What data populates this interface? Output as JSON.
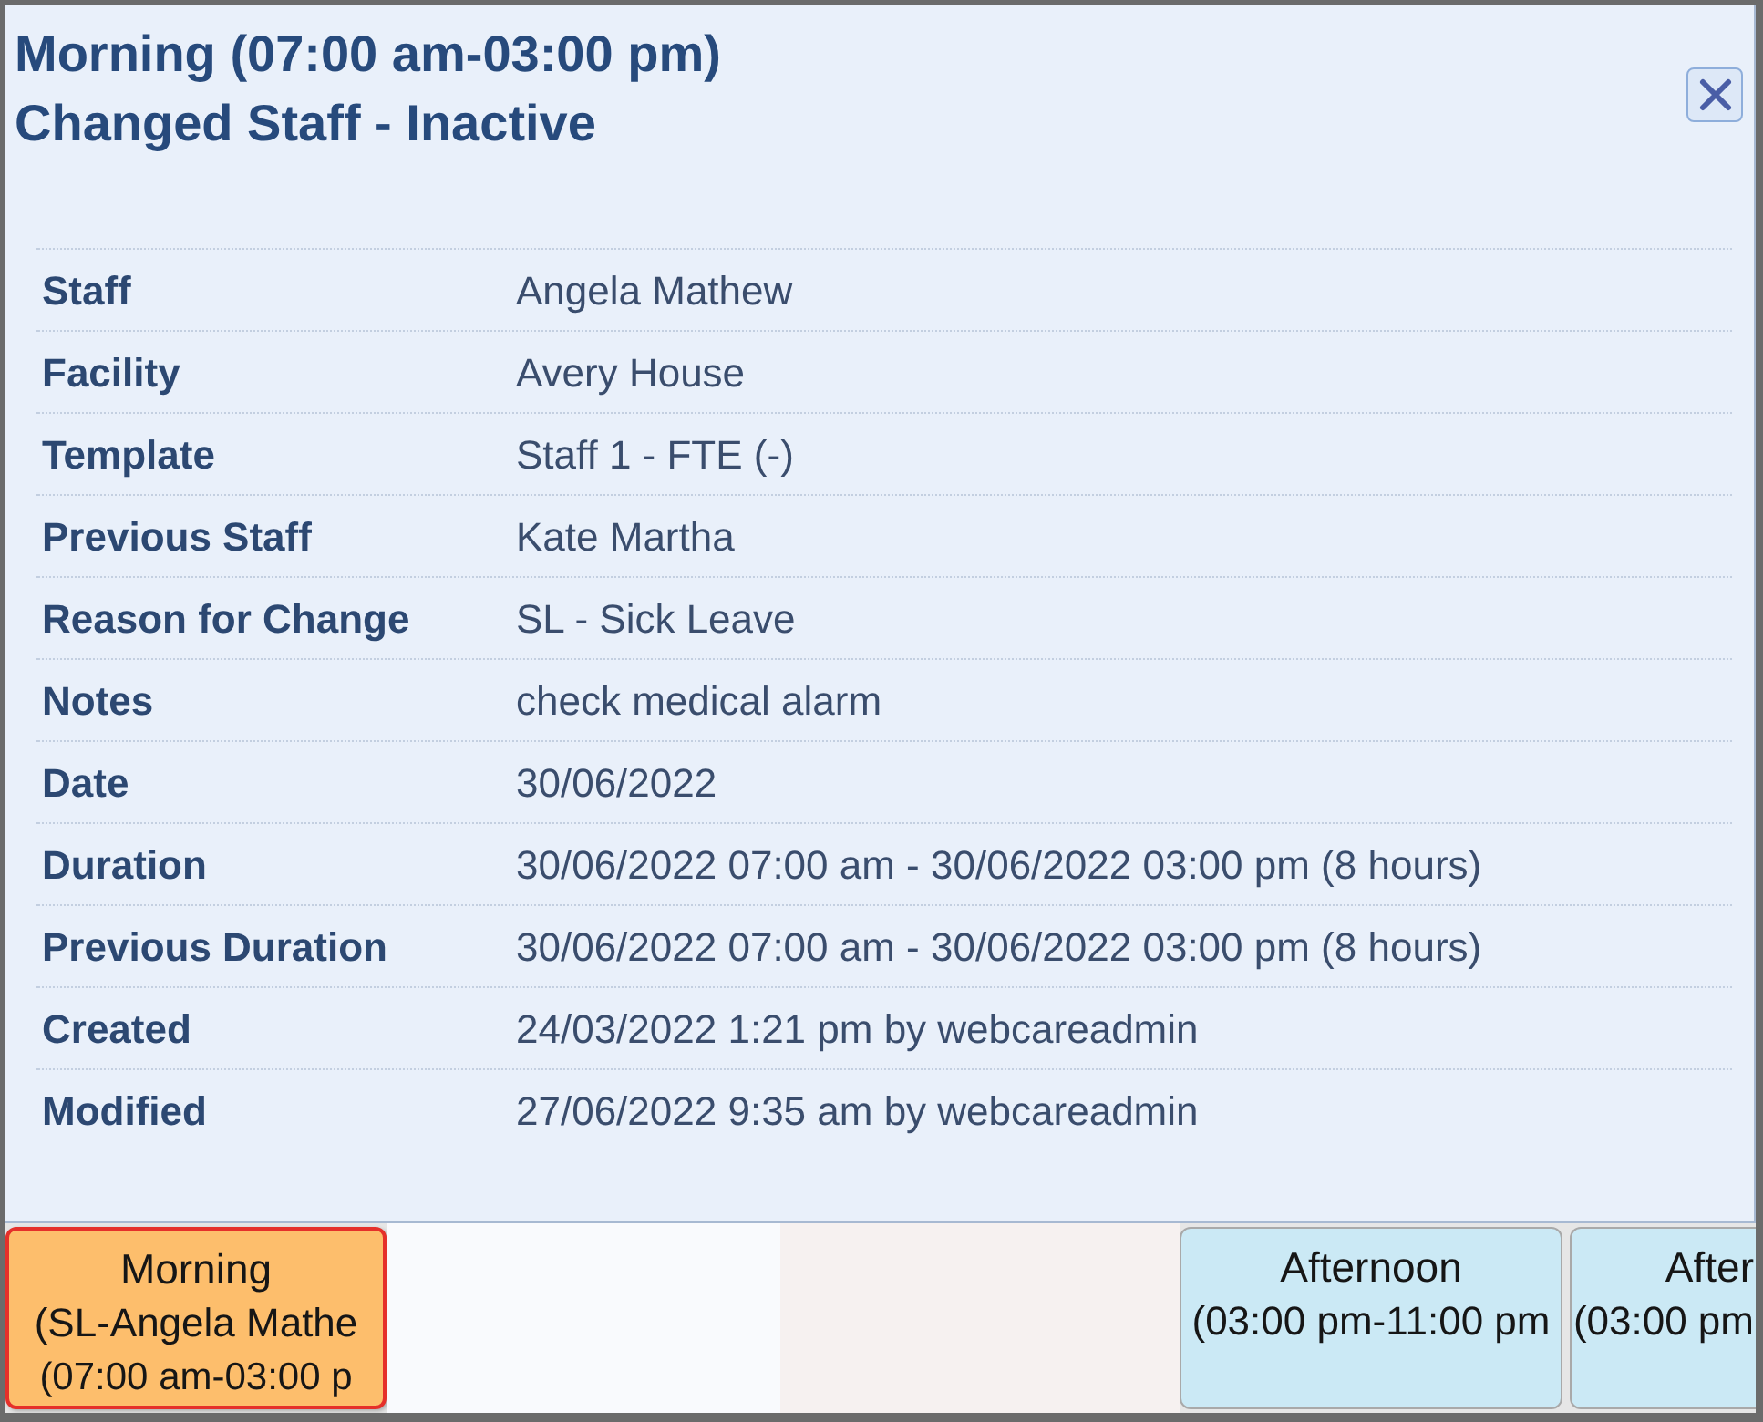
{
  "popup": {
    "title": "Morning (07:00 am-03:00 pm)",
    "subtitle": "Changed Staff - Inactive",
    "details": [
      {
        "label": "Staff",
        "value": "Angela Mathew"
      },
      {
        "label": "Facility",
        "value": "Avery House"
      },
      {
        "label": "Template",
        "value": "Staff 1 - FTE (-)"
      },
      {
        "label": "Previous Staff",
        "value": "Kate Martha"
      },
      {
        "label": "Reason for Change",
        "value": "SL - Sick Leave"
      },
      {
        "label": "Notes",
        "value": "check medical alarm"
      },
      {
        "label": "Date",
        "value": "30/06/2022"
      },
      {
        "label": "Duration",
        "value": "30/06/2022 07:00 am - 30/06/2022 03:00 pm (8 hours)"
      },
      {
        "label": "Previous Duration",
        "value": "30/06/2022 07:00 am - 30/06/2022 03:00 pm (8 hours)"
      },
      {
        "label": "Created",
        "value": "24/03/2022 1:21 pm by webcareadmin"
      },
      {
        "label": "Modified",
        "value": "27/06/2022 9:35 am by webcareadmin"
      }
    ]
  },
  "calendar_row": [
    {
      "kind": "changed",
      "lines": [
        "Morning",
        "(SL-Angela Mathe",
        "(07:00 am-03:00 p"
      ]
    },
    {
      "kind": "empty"
    },
    {
      "kind": "shaded"
    },
    {
      "kind": "shift",
      "lines": [
        "Afternoon",
        "(03:00 pm-11:00 pm"
      ]
    },
    {
      "kind": "shift",
      "lines": [
        "After",
        "(03:00 pm"
      ]
    }
  ]
}
